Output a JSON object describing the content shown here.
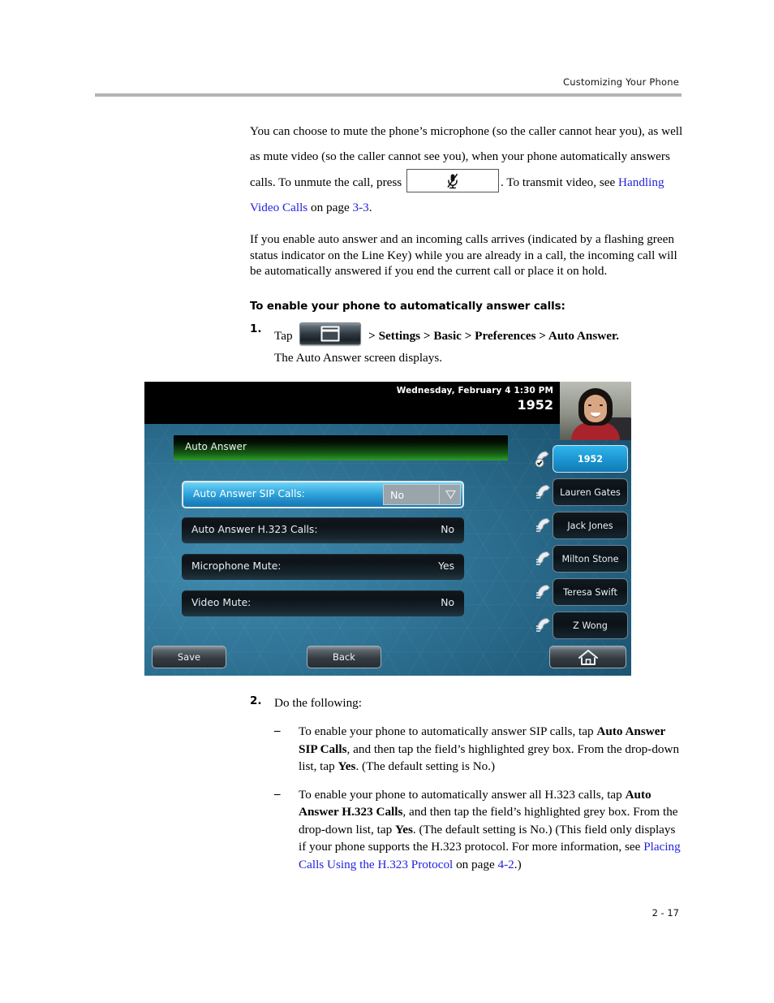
{
  "header": {
    "title": "Customizing Your Phone"
  },
  "footer": {
    "page_number": "2 - 17"
  },
  "body": {
    "para1_part1": "You can choose to mute the phone’s microphone (so the caller cannot hear you), as well as mute video (so the caller cannot see you), when your phone automatically answers calls. To unmute the call, press",
    "para1_part2": ". To transmit video, see",
    "para1_link": "Handling Video Calls",
    "para1_part3": "on page",
    "para1_pagelink": "3-3",
    "para1_end": ".",
    "para2": "If you enable auto answer and an incoming calls arrives (indicated by a flashing green status indicator on the Line Key) while you are already in a call, the incoming call will be automatically answered if you end the current call or place it on hold.",
    "section_heading": "To enable your phone to automatically answer calls:",
    "step1": {
      "number": "1.",
      "tap_label": "Tap",
      "breadcrumb": "> Settings > Basic > Preferences > Auto Answer.",
      "result": "The Auto Answer screen displays."
    },
    "step2": {
      "number": "2.",
      "lead": "Do the following:",
      "bullets": [
        {
          "mark": "–",
          "text_a": "To enable your phone to automatically answer SIP calls, tap ",
          "bold_a": "Auto Answer SIP Calls",
          "text_b": ", and then tap the field’s highlighted grey box. From the drop-down list, tap ",
          "bold_b": "Yes",
          "text_c": ". (The default setting is No.)"
        },
        {
          "mark": "–",
          "text_a": "To enable your phone to automatically answer all H.323 calls, tap ",
          "bold_a": "Auto Answer H.323 Calls",
          "text_b": ", and then tap the field’s highlighted grey box. From the drop-down list, tap ",
          "bold_b": "Yes",
          "text_c": ". (The default setting is No.) (This field only displays if your phone supports the H.323 protocol. For more information, see ",
          "link": "Placing Calls Using the H.323 Protocol",
          "text_d": " on page ",
          "pagelink": "4-2",
          "text_e": ".)"
        }
      ]
    }
  },
  "phone_screen": {
    "status": {
      "datetime": "Wednesday, February 4  1:30 PM",
      "extension": "1952"
    },
    "title_bar": "Auto Answer",
    "fields": [
      {
        "label": "Auto Answer SIP Calls:",
        "value": "No",
        "selected": true
      },
      {
        "label": "Auto Answer H.323 Calls:",
        "value": "No",
        "selected": false
      },
      {
        "label": "Microphone Mute:",
        "value": "Yes",
        "selected": false
      },
      {
        "label": "Video Mute:",
        "value": "No",
        "selected": false
      }
    ],
    "line_keys": [
      {
        "label": "1952",
        "active": true
      },
      {
        "label": "Lauren Gates",
        "active": false
      },
      {
        "label": "Jack Jones",
        "active": false
      },
      {
        "label": "Milton Stone",
        "active": false
      },
      {
        "label": "Teresa Swift",
        "active": false
      },
      {
        "label": "Z Wong",
        "active": false
      }
    ],
    "soft_keys": {
      "save": "Save",
      "back": "Back",
      "home": ""
    }
  },
  "colors": {
    "link": "#2222dd",
    "rule": "#b3b3b3",
    "screen_blue": "#2f7294",
    "title_green": "#2e9e2b",
    "selected_row": "#35a9df"
  }
}
